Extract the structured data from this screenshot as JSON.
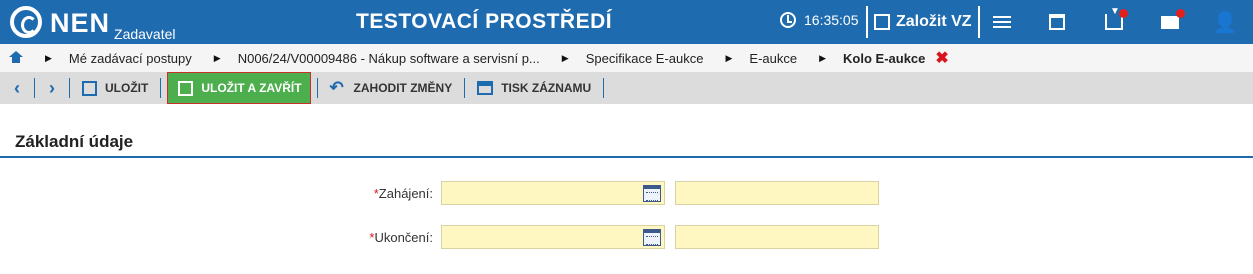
{
  "app": {
    "logo_text": "NEN",
    "logo_sub": "Zadavatel",
    "environment": "TESTOVACÍ PROSTŘEDÍ",
    "clock": "16:35:05",
    "create_label": "Založit VZ"
  },
  "breadcrumb": {
    "items": [
      "Mé zadávací postupy",
      "N006/24/V00009486 - Nákup software a servisní p...",
      "Specifikace E-aukce",
      "E-aukce",
      "Kolo E-aukce"
    ],
    "close_symbol": "✖"
  },
  "toolbar": {
    "save_label": "ULOŽIT",
    "save_close_label": "ULOŽIT A ZAVŘÍT",
    "discard_label": "ZAHODIT ZMĚNY",
    "print_label": "TISK ZÁZNAMU"
  },
  "section": {
    "title": "Základní údaje"
  },
  "form": {
    "start_label": "Zahájení:",
    "end_label": "Ukončení:"
  },
  "icons": {
    "notification": "red-dot",
    "required_mark": "*"
  },
  "colors": {
    "brand": "#1f6bb0",
    "save_close": "#4cae4c",
    "required": "#d9141e",
    "input": "#fff7c2"
  }
}
